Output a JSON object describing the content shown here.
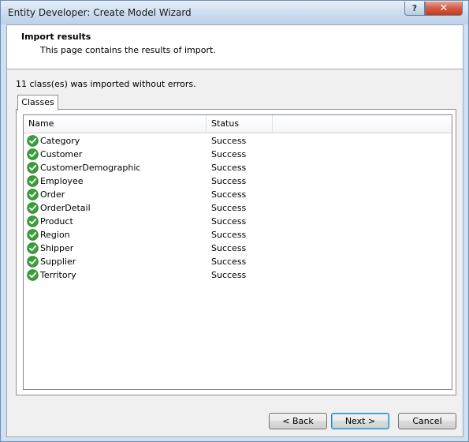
{
  "window": {
    "title": "Entity Developer: Create Model Wizard",
    "help_label": "?",
    "close_label": "✕"
  },
  "header": {
    "title": "Import results",
    "subtitle": "This page contains the results of import."
  },
  "summary": "11 class(es) was imported without errors.",
  "tabs": [
    {
      "label": "Classes",
      "selected": true
    }
  ],
  "table": {
    "columns": [
      "Name",
      "Status"
    ],
    "row_icon": "green-check-icon",
    "rows": [
      {
        "name": "Category",
        "status": "Success"
      },
      {
        "name": "Customer",
        "status": "Success"
      },
      {
        "name": "CustomerDemographic",
        "status": "Success"
      },
      {
        "name": "Employee",
        "status": "Success"
      },
      {
        "name": "Order",
        "status": "Success"
      },
      {
        "name": "OrderDetail",
        "status": "Success"
      },
      {
        "name": "Product",
        "status": "Success"
      },
      {
        "name": "Region",
        "status": "Success"
      },
      {
        "name": "Shipper",
        "status": "Success"
      },
      {
        "name": "Supplier",
        "status": "Success"
      },
      {
        "name": "Territory",
        "status": "Success"
      }
    ]
  },
  "buttons": {
    "back": "< Back",
    "next": "Next >",
    "cancel": "Cancel"
  },
  "colors": {
    "success_green": "#3aa13a",
    "window_frame": "#cfe0f1",
    "close_red": "#c23a1f"
  }
}
